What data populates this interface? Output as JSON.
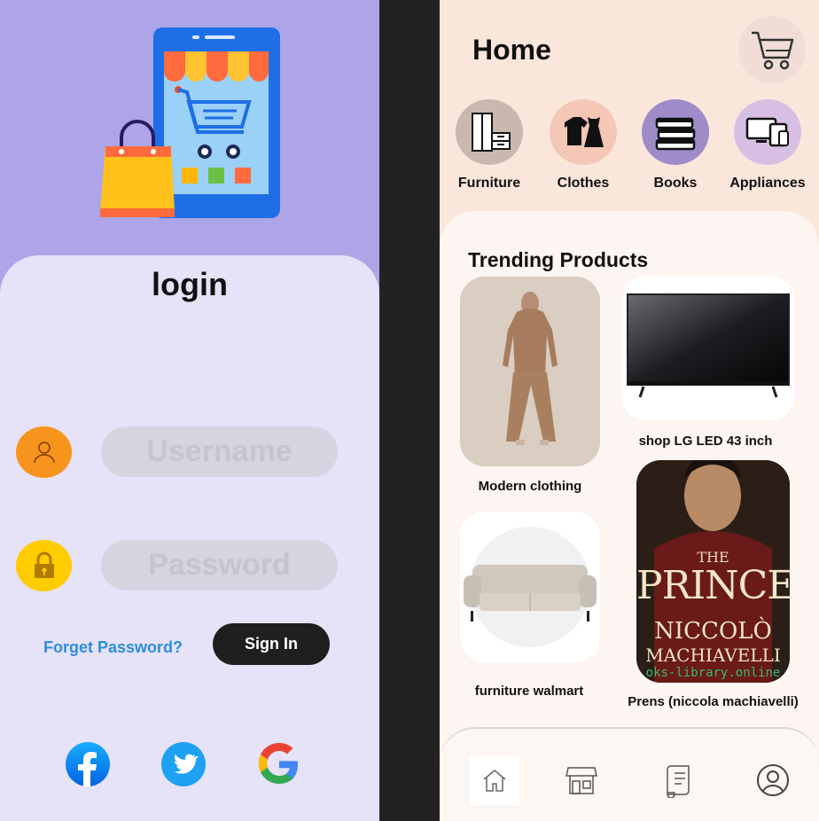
{
  "login": {
    "title": "login",
    "username_placeholder": "Username",
    "password_placeholder": "Password",
    "forgot_label": "Forget Password?",
    "signin_label": "Sign In",
    "social": [
      "facebook-icon",
      "twitter-icon",
      "google-icon"
    ],
    "colors": {
      "hero_bg": "#ada5e8",
      "card_bg": "#e6e2f8",
      "user_icon_bg": "#f7941d",
      "lock_icon_bg": "#ffcc00",
      "link": "#2c8ed9",
      "button": "#1f1f1f"
    }
  },
  "home": {
    "title": "Home",
    "cart_icon": "cart-icon",
    "categories": [
      {
        "label": "Furniture",
        "icon": "furniture-icon",
        "color": "#c8b8ae"
      },
      {
        "label": "Clothes",
        "icon": "clothes-icon",
        "color": "#f5c7b6"
      },
      {
        "label": "Books",
        "icon": "books-icon",
        "color": "#9e8bc8"
      },
      {
        "label": "Appliances",
        "icon": "appliances-icon",
        "color": "#d7bfe4"
      }
    ],
    "trending_title": "Trending Products",
    "products": [
      {
        "label": "Modern clothing"
      },
      {
        "label": "shop LG LED 43 inch"
      },
      {
        "label": "furniture walmart"
      },
      {
        "label": "Prens (niccola machiavelli)",
        "book_title": "THE",
        "book_main": "PRINCE",
        "book_author1": "NICCOLÒ",
        "book_author2": "MACHIAVELLI",
        "book_watermark": "oks-library.online"
      }
    ],
    "nav": [
      "home-icon",
      "store-icon",
      "orders-icon",
      "profile-icon"
    ]
  }
}
